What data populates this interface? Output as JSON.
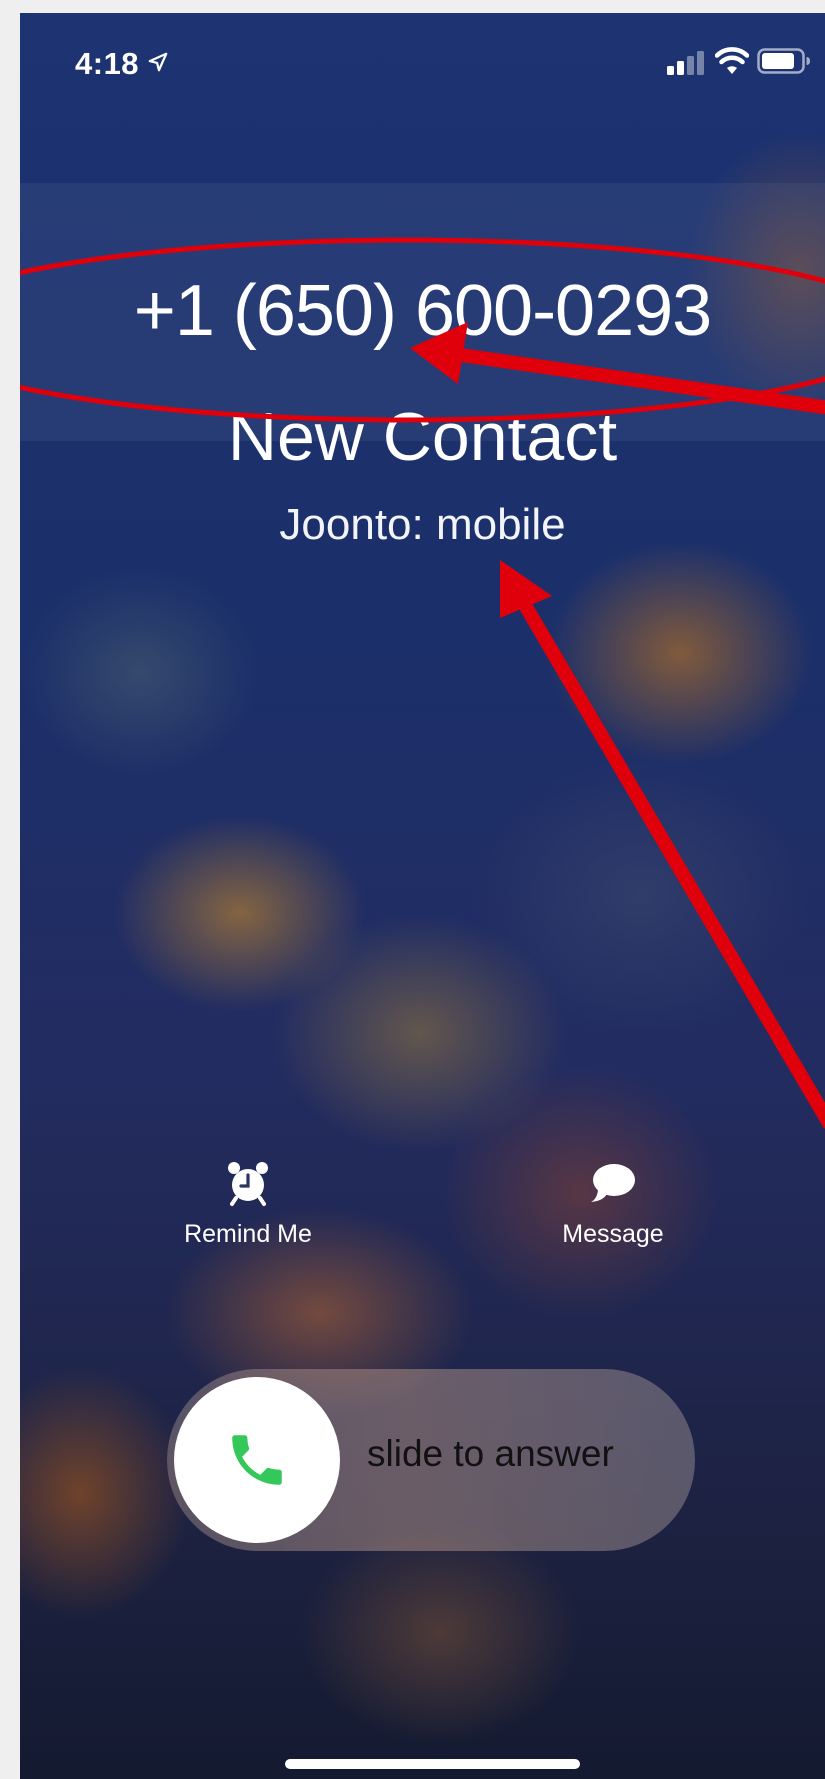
{
  "status_bar": {
    "time": "4:18",
    "location_icon": "location-arrow-icon",
    "signal_icon": "cellular-signal-icon",
    "wifi_icon": "wifi-icon",
    "battery_icon": "battery-icon"
  },
  "caller": {
    "number": "+1 (650) 600-0293",
    "name": "New Contact",
    "label": "Joonto: mobile"
  },
  "actions": {
    "remind": {
      "label": "Remind Me",
      "icon": "alarm-clock-icon"
    },
    "message": {
      "label": "Message",
      "icon": "speech-bubble-icon"
    }
  },
  "slider": {
    "text": "slide to answer",
    "icon": "phone-icon",
    "icon_color": "#34c759"
  },
  "colors": {
    "annotation": "#e0000b",
    "background": "#1b2d6b"
  }
}
